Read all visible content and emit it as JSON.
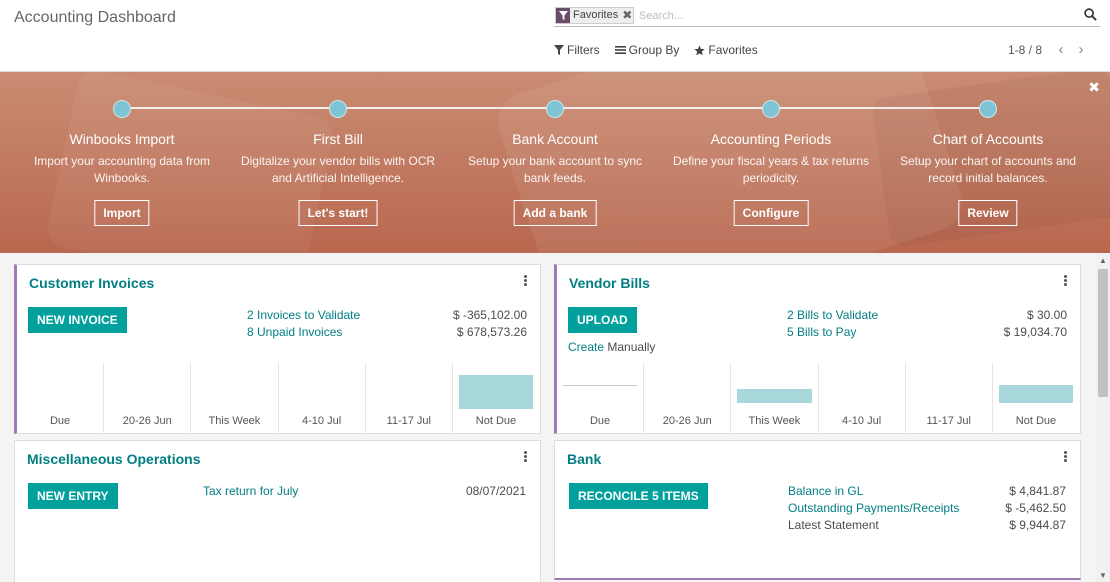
{
  "header": {
    "title": "Accounting Dashboard",
    "facet_label": "Favorites",
    "search_placeholder": "Search...",
    "filters_label": "Filters",
    "groupby_label": "Group By",
    "favorites_label": "Favorites",
    "pager_value": "1-8 / 8"
  },
  "onboarding": {
    "steps": [
      {
        "title": "Winbooks Import",
        "desc": "Import your accounting data from Winbooks.",
        "button": "Import"
      },
      {
        "title": "First Bill",
        "desc": "Digitalize your vendor bills with OCR and Artificial Intelligence.",
        "button": "Let's start!"
      },
      {
        "title": "Bank Account",
        "desc": "Setup your bank account to sync bank feeds.",
        "button": "Add a bank"
      },
      {
        "title": "Accounting Periods",
        "desc": "Define your fiscal years & tax returns periodicity.",
        "button": "Configure"
      },
      {
        "title": "Chart of Accounts",
        "desc": "Setup your chart of accounts and record initial balances.",
        "button": "Review"
      }
    ]
  },
  "customer_invoices": {
    "title": "Customer Invoices",
    "button": "NEW INVOICE",
    "stats": [
      {
        "label": "2 Invoices to Validate",
        "amount": "$ -365,102.00"
      },
      {
        "label": "8 Unpaid Invoices",
        "amount": "$ 678,573.26"
      }
    ],
    "chart": {
      "labels": [
        "Due",
        "20-26 Jun",
        "This Week",
        "4-10 Jul",
        "11-17 Jul",
        "Not Due"
      ],
      "values": [
        0,
        0,
        0,
        0,
        0,
        678573.26
      ]
    }
  },
  "vendor_bills": {
    "title": "Vendor Bills",
    "button": "UPLOAD",
    "create_manually_link": "Create",
    "create_manually_text": "Manually",
    "stats": [
      {
        "label": "2 Bills to Validate",
        "amount": "$ 30.00"
      },
      {
        "label": "5 Bills to Pay",
        "amount": "$ 19,034.70"
      }
    ],
    "chart": {
      "labels": [
        "Due",
        "20-26 Jun",
        "This Week",
        "4-10 Jul",
        "11-17 Jul",
        "Not Due"
      ],
      "values": [
        0,
        0,
        0.35,
        0,
        0,
        0.45
      ]
    }
  },
  "misc_operations": {
    "title": "Miscellaneous Operations",
    "button": "NEW ENTRY",
    "item_label": "Tax return for July",
    "item_date": "08/07/2021"
  },
  "bank": {
    "title": "Bank",
    "button": "RECONCILE 5 ITEMS",
    "stats": [
      {
        "label": "Balance in GL",
        "amount": "$ 4,841.87"
      },
      {
        "label": "Outstanding Payments/Receipts",
        "amount": "$ -5,462.50"
      },
      {
        "label": "Latest Statement",
        "amount": "$ 9,944.87"
      }
    ]
  },
  "colors": {
    "primary": "#00a09d",
    "link": "#017e84",
    "banner": "#c27c63",
    "step_dot": "#7fc4d4",
    "chart_bar": "#a8d8dc"
  }
}
